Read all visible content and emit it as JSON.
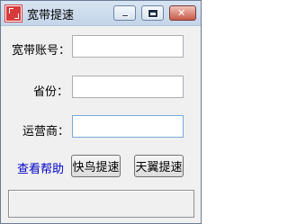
{
  "window": {
    "title": "宽带提速",
    "icon": "red-seal-icon"
  },
  "form": {
    "account_label": "宽带账号：",
    "account_value": "",
    "province_label": "省份：",
    "province_value": "",
    "carrier_label": "运营商：",
    "carrier_value": ""
  },
  "actions": {
    "help_label": "查看帮助",
    "kuainiao_label": "快鸟提速",
    "tianyi_label": "天翼提速"
  },
  "status": {
    "text": ""
  },
  "colors": {
    "link": "#0000c8",
    "window_bg": "#f0f0f0",
    "close_button": "#c75a48"
  }
}
